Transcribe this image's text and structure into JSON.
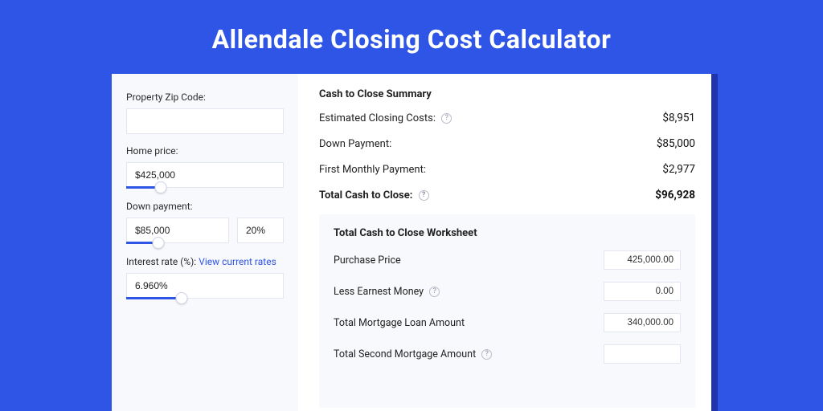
{
  "page": {
    "title": "Allendale Closing Cost Calculator"
  },
  "form": {
    "zip_label": "Property Zip Code:",
    "zip_value": "",
    "home_price_label": "Home price:",
    "home_price_value": "$425,000",
    "down_payment_label": "Down payment:",
    "down_payment_value": "$85,000",
    "down_payment_pct": "20%",
    "interest_label": "Interest rate (%):",
    "interest_link": "View current rates",
    "interest_value": "6.960%"
  },
  "summary": {
    "title": "Cash to Close Summary",
    "rows": [
      {
        "label": "Estimated Closing Costs:",
        "value": "$8,951",
        "help": true
      },
      {
        "label": "Down Payment:",
        "value": "$85,000",
        "help": false
      },
      {
        "label": "First Monthly Payment:",
        "value": "$2,977",
        "help": false
      }
    ],
    "total": {
      "label": "Total Cash to Close:",
      "value": "$96,928",
      "help": true
    }
  },
  "worksheet": {
    "title": "Total Cash to Close Worksheet",
    "rows": [
      {
        "label": "Purchase Price",
        "value": "425,000.00",
        "help": false
      },
      {
        "label": "Less Earnest Money",
        "value": "0.00",
        "help": true
      },
      {
        "label": "Total Mortgage Loan Amount",
        "value": "340,000.00",
        "help": false
      },
      {
        "label": "Total Second Mortgage Amount",
        "value": "",
        "help": true
      }
    ]
  }
}
